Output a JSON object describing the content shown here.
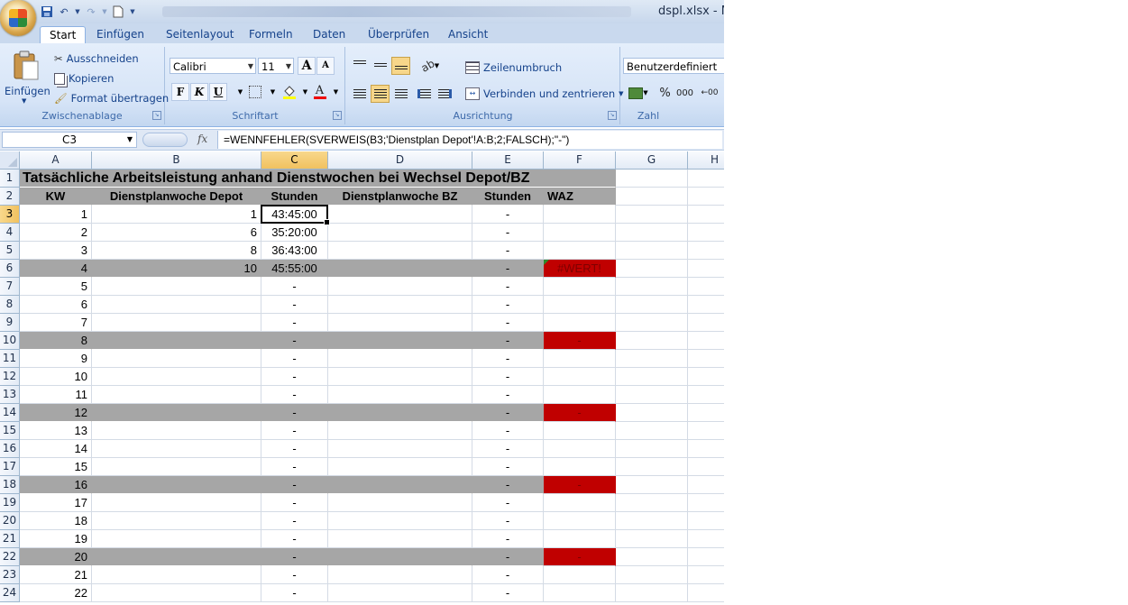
{
  "window": {
    "title": "dspl.xlsx - Mic"
  },
  "ribbon": {
    "tabs": [
      "Start",
      "Einfügen",
      "Seitenlayout",
      "Formeln",
      "Daten",
      "Überprüfen",
      "Ansicht"
    ],
    "active_tab": "Start",
    "clipboard": {
      "paste": "Einfügen",
      "cut": "Ausschneiden",
      "copy": "Kopieren",
      "format_painter": "Format übertragen",
      "label": "Zwischenablage"
    },
    "font": {
      "name": "Calibri",
      "size": "11",
      "bold": "F",
      "italic": "K",
      "underline": "U",
      "font_color_glyph": "A",
      "grow": "A",
      "shrink": "A",
      "label": "Schriftart"
    },
    "alignment": {
      "wrap": "Zeilenumbruch",
      "merge": "Verbinden und zentrieren",
      "label": "Ausrichtung"
    },
    "number": {
      "format": "Benutzerdefiniert",
      "percent": "%",
      "thousands": "000",
      "decimals": "00",
      "label": "Zahl"
    }
  },
  "formula_bar": {
    "name_box": "C3",
    "fx": "fx",
    "formula": "=WENNFEHLER(SVERWEIS(B3;'Dienstplan Depot'!A:B;2;FALSCH);\"-\")"
  },
  "grid": {
    "columns": [
      "A",
      "B",
      "C",
      "D",
      "E",
      "F",
      "G",
      "H"
    ],
    "selected_column": "C",
    "selected_row": 3,
    "title": "Tatsächliche Arbeitsleistung anhand Dienstwochen bei Wechsel Depot/BZ",
    "headers": [
      "KW",
      "Dienstplanwoche Depot",
      "Stunden",
      "Dienstplanwoche BZ",
      "Stunden",
      "WAZ"
    ],
    "rows": [
      {
        "n": 3,
        "a": "1",
        "b": "1",
        "c": "43:45:00",
        "e": "-",
        "f": "",
        "gray": false,
        "red": false
      },
      {
        "n": 4,
        "a": "2",
        "b": "6",
        "c": "35:20:00",
        "e": "-",
        "f": "",
        "gray": false,
        "red": false
      },
      {
        "n": 5,
        "a": "3",
        "b": "8",
        "c": "36:43:00",
        "e": "-",
        "f": "",
        "gray": false,
        "red": false
      },
      {
        "n": 6,
        "a": "4",
        "b": "10",
        "c": "45:55:00",
        "e": "-",
        "f": "#WERT!",
        "gray": true,
        "red": true
      },
      {
        "n": 7,
        "a": "5",
        "b": "",
        "c": "-",
        "e": "-",
        "f": "",
        "gray": false,
        "red": false
      },
      {
        "n": 8,
        "a": "6",
        "b": "",
        "c": "-",
        "e": "-",
        "f": "",
        "gray": false,
        "red": false
      },
      {
        "n": 9,
        "a": "7",
        "b": "",
        "c": "-",
        "e": "-",
        "f": "",
        "gray": false,
        "red": false
      },
      {
        "n": 10,
        "a": "8",
        "b": "",
        "c": "-",
        "e": "-",
        "f": "-",
        "gray": true,
        "red": true
      },
      {
        "n": 11,
        "a": "9",
        "b": "",
        "c": "-",
        "e": "-",
        "f": "",
        "gray": false,
        "red": false
      },
      {
        "n": 12,
        "a": "10",
        "b": "",
        "c": "-",
        "e": "-",
        "f": "",
        "gray": false,
        "red": false
      },
      {
        "n": 13,
        "a": "11",
        "b": "",
        "c": "-",
        "e": "-",
        "f": "",
        "gray": false,
        "red": false
      },
      {
        "n": 14,
        "a": "12",
        "b": "",
        "c": "-",
        "e": "-",
        "f": "-",
        "gray": true,
        "red": true
      },
      {
        "n": 15,
        "a": "13",
        "b": "",
        "c": "-",
        "e": "-",
        "f": "",
        "gray": false,
        "red": false
      },
      {
        "n": 16,
        "a": "14",
        "b": "",
        "c": "-",
        "e": "-",
        "f": "",
        "gray": false,
        "red": false
      },
      {
        "n": 17,
        "a": "15",
        "b": "",
        "c": "-",
        "e": "-",
        "f": "",
        "gray": false,
        "red": false
      },
      {
        "n": 18,
        "a": "16",
        "b": "",
        "c": "-",
        "e": "-",
        "f": "-",
        "gray": true,
        "red": true
      },
      {
        "n": 19,
        "a": "17",
        "b": "",
        "c": "-",
        "e": "-",
        "f": "",
        "gray": false,
        "red": false
      },
      {
        "n": 20,
        "a": "18",
        "b": "",
        "c": "-",
        "e": "-",
        "f": "",
        "gray": false,
        "red": false
      },
      {
        "n": 21,
        "a": "19",
        "b": "",
        "c": "-",
        "e": "-",
        "f": "",
        "gray": false,
        "red": false
      },
      {
        "n": 22,
        "a": "20",
        "b": "",
        "c": "-",
        "e": "-",
        "f": "-",
        "gray": true,
        "red": true
      },
      {
        "n": 23,
        "a": "21",
        "b": "",
        "c": "-",
        "e": "-",
        "f": "",
        "gray": false,
        "red": false
      },
      {
        "n": 24,
        "a": "22",
        "b": "",
        "c": "-",
        "e": "-",
        "f": "",
        "gray": false,
        "red": false
      }
    ]
  },
  "colors": {
    "gray_row": "#a6a6a6",
    "red_cell": "#c00000",
    "error_text": "#7f0000",
    "selection": "#f1c15f"
  }
}
